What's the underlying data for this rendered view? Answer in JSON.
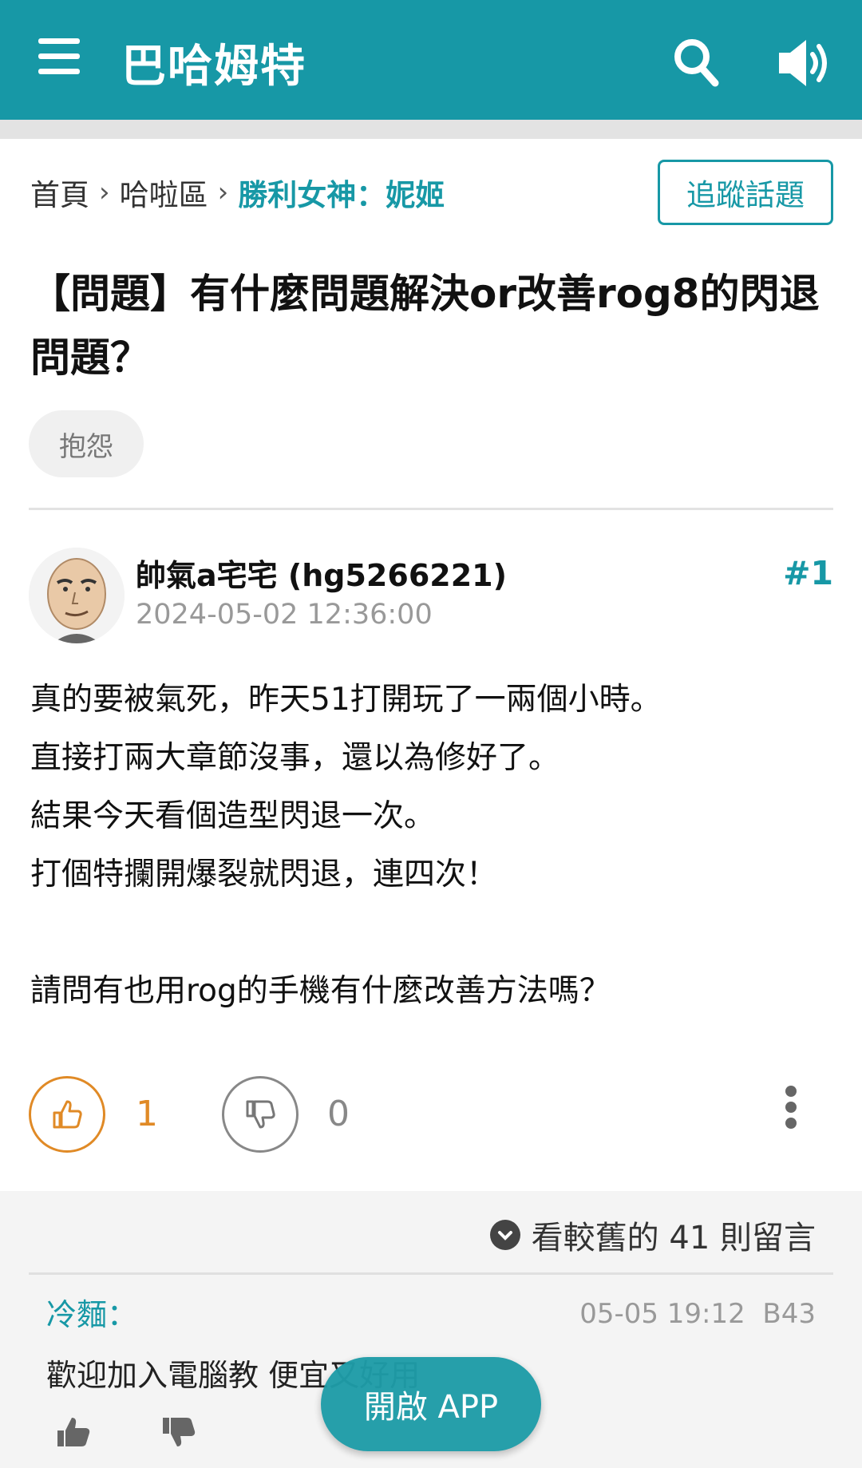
{
  "header": {
    "title": "巴哈姆特",
    "icons": [
      "menu-icon",
      "search-icon",
      "speaker-icon"
    ],
    "color": "#1798a6"
  },
  "breadcrumb": {
    "home": "首頁",
    "board": "哈啦區",
    "current": "勝利女神：妮姬",
    "separator": "›"
  },
  "follow_button": "追蹤話題",
  "post": {
    "title": "【問題】有什麼問題解決or改善rog8的閃退問題？",
    "tag": "抱怨",
    "author": "帥氣a宅宅 (hg5266221)",
    "time": "2024-05-02 12:36:00",
    "floor": "#1",
    "content": [
      "真的要被氣死，昨天51打開玩了一兩個小時。",
      "直接打兩大章節沒事，還以為修好了。",
      "結果今天看個造型閃退一次。",
      "打個特攔開爆裂就閃退，連四次！",
      "",
      "請問有也用rog的手機有什麼改善方法嗎？"
    ],
    "likes": "1",
    "dislikes": "0"
  },
  "comments": {
    "older_label": "看較舊的 41 則留言",
    "items": [
      {
        "user": "冷麵：",
        "time": "05-05 19:12",
        "floor": "B43",
        "text": "歡迎加入電腦教 便宜又好用"
      }
    ]
  },
  "app_button": "開啟 APP"
}
